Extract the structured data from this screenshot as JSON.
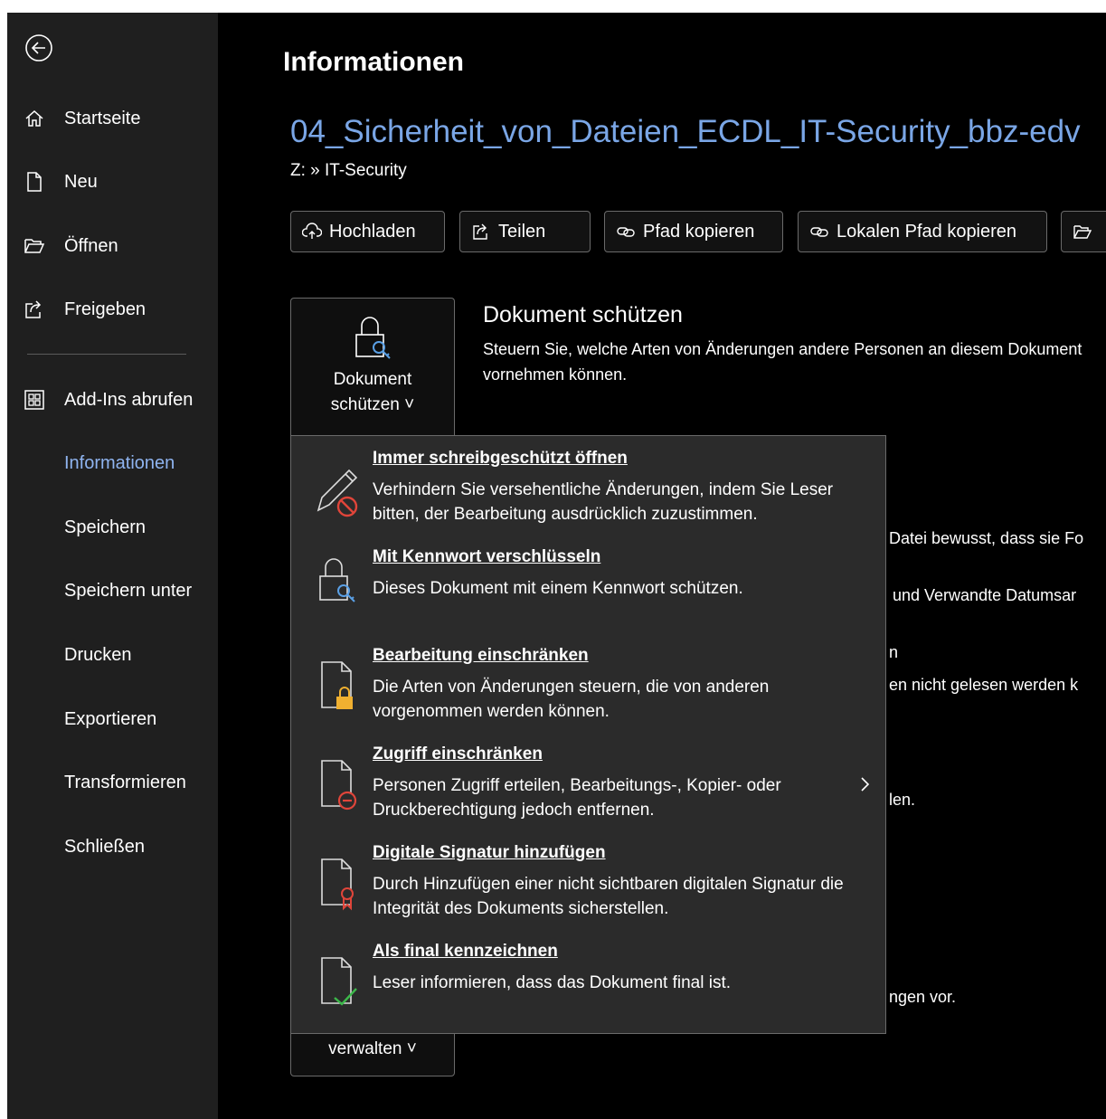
{
  "sidebar": {
    "items": [
      {
        "label": "Startseite",
        "icon": "home-icon"
      },
      {
        "label": "Neu",
        "icon": "new-document-icon"
      },
      {
        "label": "Öffnen",
        "icon": "folder-open-icon"
      },
      {
        "label": "Freigeben",
        "icon": "share-icon"
      },
      {
        "label": "Add-Ins abrufen",
        "icon": "add-ins-icon"
      },
      {
        "label": "Informationen"
      },
      {
        "label": "Speichern"
      },
      {
        "label": "Speichern unter"
      },
      {
        "label": "Drucken"
      },
      {
        "label": "Exportieren"
      },
      {
        "label": "Transformieren"
      },
      {
        "label": "Schließen"
      }
    ],
    "active_item": "Informationen"
  },
  "main": {
    "page_title": "Informationen",
    "doc_title": "04_Sicherheit_von_Dateien_ECDL_IT-Security_bbz-edv",
    "doc_path": "Z: » IT-Security",
    "actions": [
      "Hochladen",
      "Teilen",
      "Pfad kopieren",
      "Lokalen Pfad kopieren"
    ],
    "protect": {
      "button_line1": "Dokument",
      "button_line2": "schützen ˅",
      "title": "Dokument schützen",
      "desc_line1": "Steuern Sie, welche Arten von Änderungen andere Personen an diesem Dokument",
      "desc_line2": "vornehmen können."
    },
    "manage_button": "verwalten ˅",
    "background_fragments": [
      "Datei bewusst, dass sie Fo",
      "und Verwandte Datumsar",
      "n",
      "en nicht gelesen werden k",
      "len.",
      "ngen vor."
    ]
  },
  "menu": {
    "items": [
      {
        "title": "Immer schreibgeschützt öffnen",
        "desc": "Verhindern Sie versehentliche Änderungen, indem Sie Leser bitten, der Bearbeitung ausdrücklich zuzustimmen."
      },
      {
        "title": "Mit Kennwort verschlüsseln",
        "desc": "Dieses Dokument mit einem Kennwort schützen."
      },
      {
        "title": "Bearbeitung einschränken",
        "desc": "Die Arten von Änderungen steuern, die von anderen vorgenommen werden können."
      },
      {
        "title": "Zugriff einschränken",
        "desc": "Personen Zugriff erteilen, Bearbeitungs-, Kopier- oder Druckberechtigung jedoch entfernen."
      },
      {
        "title": "Digitale Signatur hinzufügen",
        "desc": "Durch Hinzufügen einer nicht sichtbaren digitalen Signatur die Integrität des Dokuments sicherstellen."
      },
      {
        "title": "Als final kennzeichnen",
        "desc": "Leser informieren, dass das Dokument final ist."
      }
    ]
  },
  "colors": {
    "accent": "#7aa6e6",
    "sidebar_bg": "#1f1f1f",
    "menu_bg": "#2b2b2b"
  }
}
